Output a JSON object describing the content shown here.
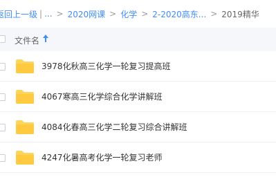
{
  "breadcrumb": {
    "back_label": "返回上一级",
    "ellipsis": "...",
    "separator": ">",
    "items": [
      {
        "label": "2020网课"
      },
      {
        "label": "化学"
      },
      {
        "label": "2-2020高东..."
      }
    ],
    "current": "2019精华"
  },
  "list": {
    "header_label": "文件名",
    "sort_icon": "arrow-up-icon",
    "rows": [
      {
        "name": "3978化秋高三化学一轮复习提高班",
        "icon": "folder-icon"
      },
      {
        "name": "4067寒高三化学综合化学讲解班",
        "icon": "folder-icon"
      },
      {
        "name": "4084化春高三化学二轮复习综合讲解班",
        "icon": "folder-icon"
      },
      {
        "name": "4247化暑高考化学一轮复习老师",
        "icon": "folder-icon"
      }
    ]
  },
  "colors": {
    "link": "#3f8df6",
    "folder": "#ffd45a",
    "header_bg": "#f5f7fa"
  }
}
